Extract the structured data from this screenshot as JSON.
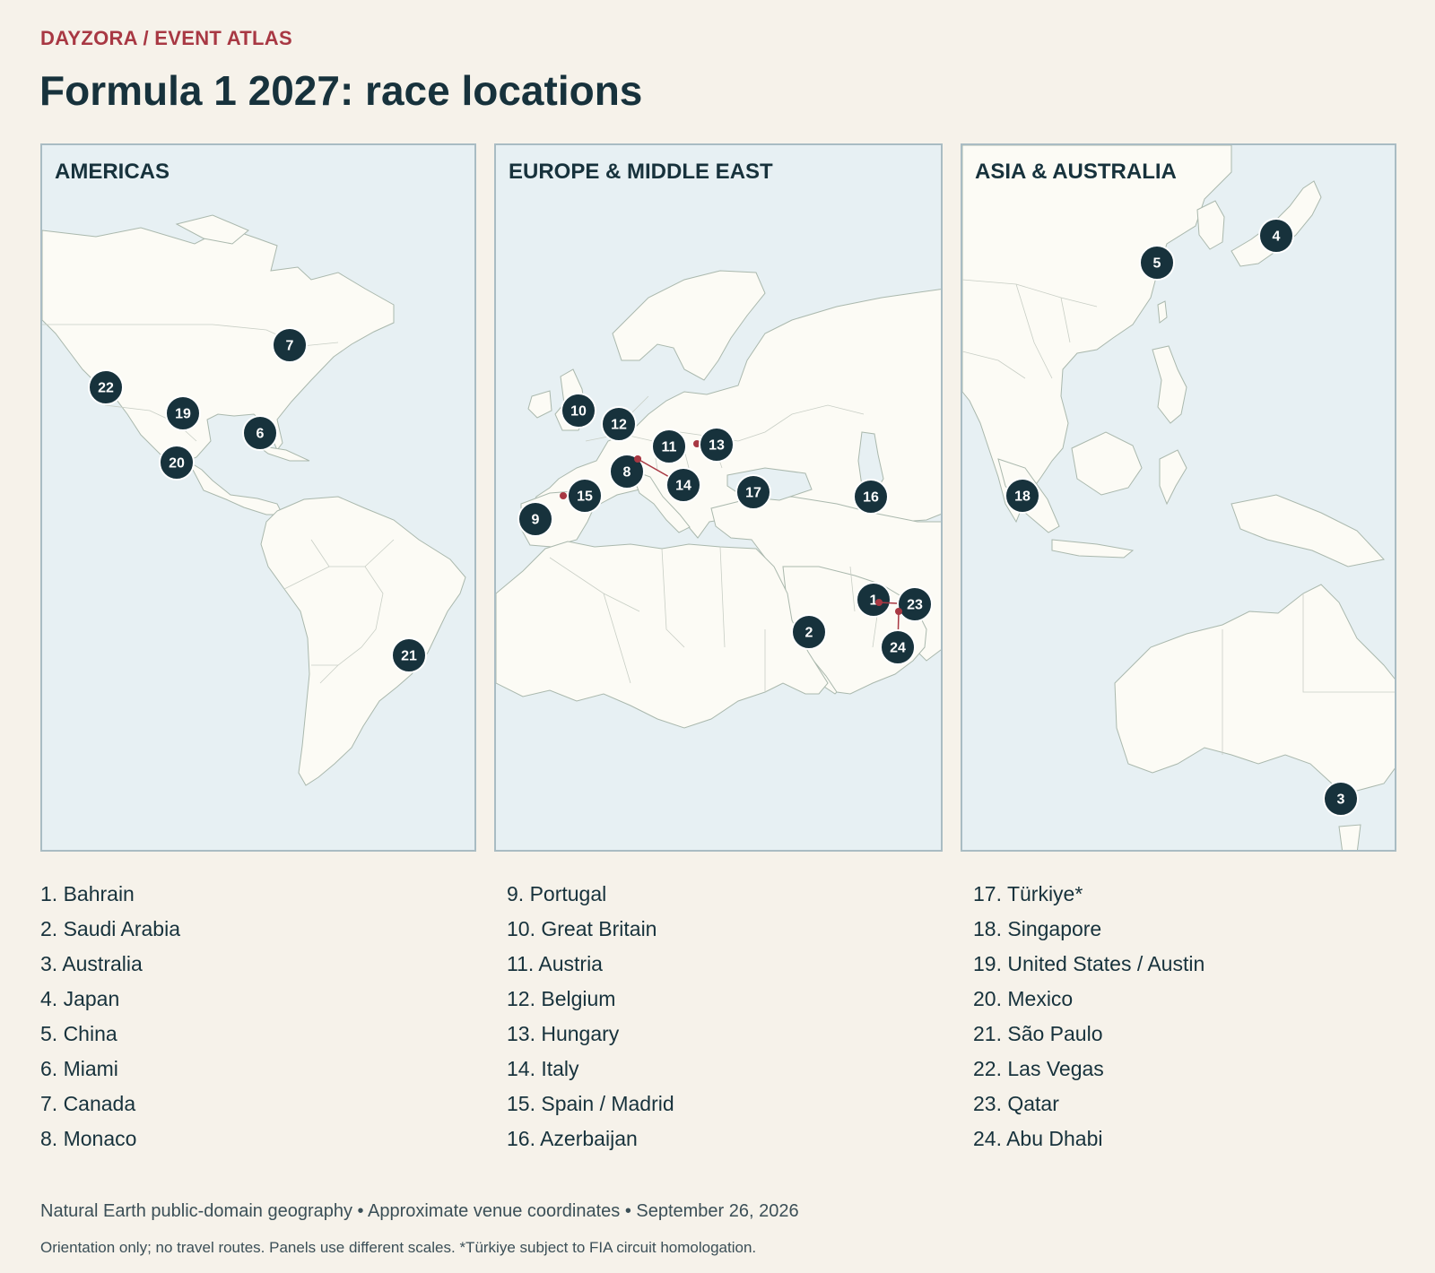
{
  "header": {
    "kicker": "DAYZORA / EVENT ATLAS",
    "title": "Formula 1 2027: race locations"
  },
  "panels": [
    {
      "id": "americas",
      "label": "AMERICAS"
    },
    {
      "id": "europe",
      "label": "EUROPE & MIDDLE EAST"
    },
    {
      "id": "asia",
      "label": "ASIA & AUSTRALIA"
    }
  ],
  "markers": {
    "americas": [
      "7",
      "22",
      "19",
      "6",
      "20",
      "21"
    ],
    "europe": [
      "10",
      "12",
      "11",
      "13",
      "8",
      "14",
      "15",
      "9",
      "17",
      "16",
      "1",
      "23",
      "2",
      "24"
    ],
    "asia": [
      "4",
      "5",
      "18",
      "3"
    ]
  },
  "legend": {
    "col1": [
      "1. Bahrain",
      "2. Saudi Arabia",
      "3. Australia",
      "4. Japan",
      "5. China",
      "6. Miami",
      "7. Canada",
      "8. Monaco"
    ],
    "col2": [
      "9. Portugal",
      "10. Great Britain",
      "11. Austria",
      "12. Belgium",
      "13. Hungary",
      "14. Italy",
      "15. Spain / Madrid",
      "16. Azerbaijan"
    ],
    "col3": [
      "17. Türkiye*",
      "18. Singapore",
      "19. United States / Austin",
      "20. Mexico",
      "21. São Paulo",
      "22. Las Vegas",
      "23. Qatar",
      "24. Abu Dhabi"
    ]
  },
  "footer": {
    "source": "Natural Earth public-domain geography • Approximate venue coordinates • September 26, 2026",
    "note": "Orientation only; no travel routes. Panels use different scales. *Türkiye subject to FIA circuit homologation."
  },
  "colors": {
    "accent": "#a83843",
    "ink": "#17323c",
    "ocean": "#e7f0f3",
    "land": "#fcfbf5",
    "background": "#f6f2ea"
  }
}
